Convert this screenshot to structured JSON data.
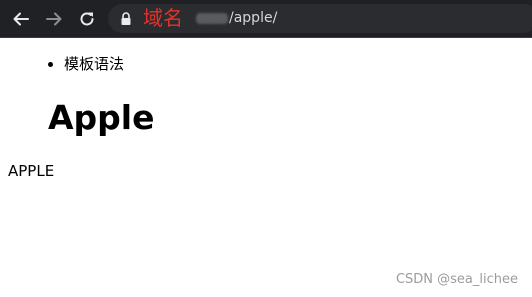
{
  "browser": {
    "domain_label": "域名",
    "url_path": "/apple/",
    "icons": {
      "back": "arrow-left-icon",
      "forward": "arrow-right-icon",
      "reload": "reload-icon",
      "lock": "lock-icon"
    },
    "colors": {
      "toolbar_bg": "#202124",
      "domain_label": "#e2322b"
    }
  },
  "page": {
    "list_items": [
      "模板语法"
    ],
    "heading": "Apple",
    "body_text": "APPLE"
  },
  "watermark": "CSDN @sea_lichee"
}
